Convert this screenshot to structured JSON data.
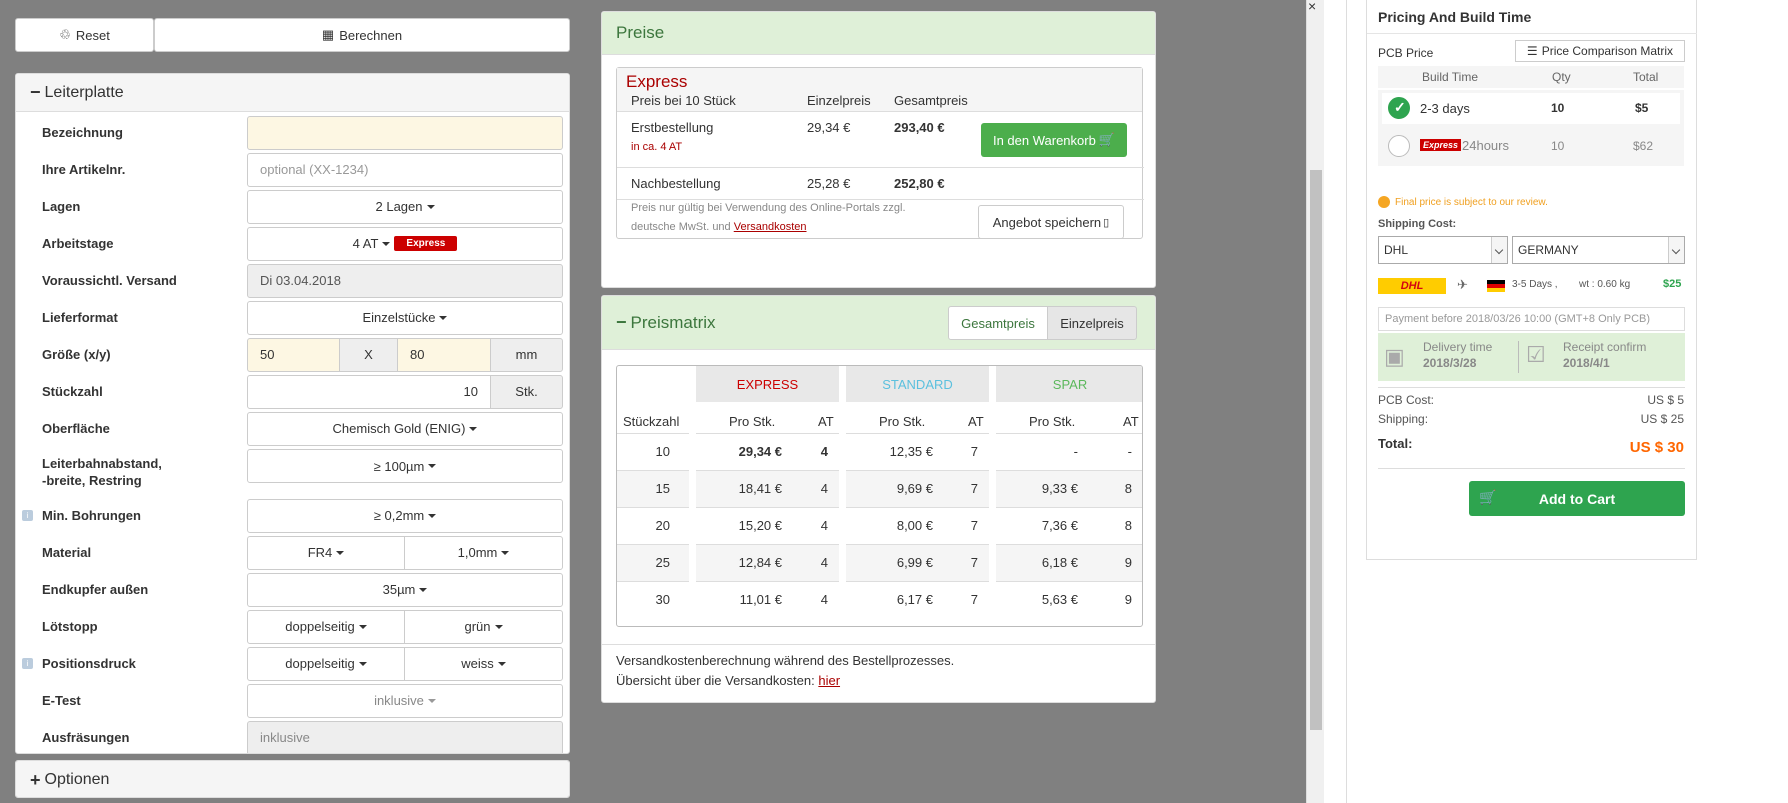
{
  "toolbar": {
    "reset_label": "Reset",
    "calc_label": "Berechnen"
  },
  "leiterplatte": {
    "title": "Leiterplatte",
    "bezeichnung_label": "Bezeichnung",
    "artikel_label": "Ihre Artikelnr.",
    "artikel_placeholder": "optional (XX-1234)",
    "lagen_label": "Lagen",
    "lagen_value": "2 Lagen",
    "arbeitstage_label": "Arbeitstage",
    "arbeitstage_value": "4 AT",
    "arbeitstage_badge": "Express",
    "versand_label": "Voraussichtl. Versand",
    "versand_value": "Di 03.04.2018",
    "lieferformat_label": "Lieferformat",
    "lieferformat_value": "Einzelstücke",
    "groesse_label": "Größe (x/y)",
    "groesse_x": "50",
    "groesse_sep": "X",
    "groesse_y": "80",
    "groesse_unit": "mm",
    "stueckzahl_label": "Stückzahl",
    "stueckzahl_value": "10",
    "stueckzahl_unit": "Stk.",
    "oberflaeche_label": "Oberfläche",
    "oberflaeche_value": "Chemisch Gold (ENIG)",
    "abstand_label_1": "Leiterbahnabstand,",
    "abstand_label_2": "-breite, Restring",
    "abstand_value": "≥ 100µm",
    "bohrungen_label": "Min. Bohrungen",
    "bohrungen_value": "≥ 0,2mm",
    "material_label": "Material",
    "material_value": "FR4",
    "material_thickness": "1,0mm",
    "endkupfer_label": "Endkupfer außen",
    "endkupfer_value": "35µm",
    "loetstopp_label": "Lötstopp",
    "loetstopp_value": "doppelseitig",
    "loetstopp_color": "grün",
    "positionsdruck_label": "Positionsdruck",
    "positionsdruck_value": "doppelseitig",
    "positionsdruck_color": "weiss",
    "etest_label": "E-Test",
    "etest_value": "inklusive",
    "ausfraesungen_label": "Ausfräsungen",
    "ausfraesungen_value": "inklusive"
  },
  "optionen": {
    "title": "Optionen"
  },
  "preise": {
    "title": "Preise",
    "express": "Express",
    "subtitle": "Preis bei 10 Stück",
    "col_einzel": "Einzelpreis",
    "col_gesamt": "Gesamtpreis",
    "erst_label": "Erstbestellung",
    "erst_sub": "in ca. 4 AT",
    "erst_einzel": "29,34 €",
    "erst_gesamt": "293,40 €",
    "cart_btn": "In den Warenkorb",
    "nach_label": "Nachbestellung",
    "nach_einzel": "25,28 €",
    "nach_gesamt": "252,80 €",
    "note_1": "Preis nur gültig bei Verwendung des Online-Portals zzgl.",
    "note_2": "deutsche MwSt. und ",
    "note_link": "Versandkosten",
    "angebot_btn": "Angebot speichern"
  },
  "preismatrix": {
    "title": "Preismatrix",
    "toggle_gesamt": "Gesamtpreis",
    "toggle_einzel": "Einzelpreis",
    "group_express": "EXPRESS",
    "group_standard": "STANDARD",
    "group_spar": "SPAR",
    "col_qty": "Stückzahl",
    "col_pro": "Pro Stk.",
    "col_at": "AT",
    "rows": [
      {
        "qty": "10",
        "ex": "29,34 €",
        "ex_at": "4",
        "st": "12,35 €",
        "st_at": "7",
        "sp": "-",
        "sp_at": "-"
      },
      {
        "qty": "15",
        "ex": "18,41 €",
        "ex_at": "4",
        "st": "9,69 €",
        "st_at": "7",
        "sp": "9,33 €",
        "sp_at": "8"
      },
      {
        "qty": "20",
        "ex": "15,20 €",
        "ex_at": "4",
        "st": "8,00 €",
        "st_at": "7",
        "sp": "7,36 €",
        "sp_at": "8"
      },
      {
        "qty": "25",
        "ex": "12,84 €",
        "ex_at": "4",
        "st": "6,99 €",
        "st_at": "7",
        "sp": "6,18 €",
        "sp_at": "9"
      },
      {
        "qty": "30",
        "ex": "11,01 €",
        "ex_at": "4",
        "st": "6,17 €",
        "st_at": "7",
        "sp": "5,63 €",
        "sp_at": "9"
      }
    ],
    "footer_1": "Versandkostenberechnung während des Bestellprozesses.",
    "footer_2": "Übersicht über die Versandkosten: ",
    "footer_link": "hier"
  },
  "pricing": {
    "title": "Pricing And Build Time",
    "pcb_price_label": "PCB Price",
    "matrix_btn": "Price Comparison Matrix",
    "col_build": "Build Time",
    "col_qty": "Qty",
    "col_total": "Total",
    "opt1_time": "2-3 days",
    "opt1_qty": "10",
    "opt1_total": "$5",
    "opt2_badge": "Express",
    "opt2_time": "24hours",
    "opt2_qty": "10",
    "opt2_total": "$62",
    "final_note": "Final price is subject to our review.",
    "shipping_label": "Shipping Cost:",
    "carrier": "DHL",
    "country": "GERMANY",
    "dhl_logo": "DHL",
    "ship_days": "3-5 Days ,",
    "ship_wt": "wt : 0.60 kg",
    "ship_price": "$25",
    "payment_note": "Payment before 2018/03/26 10:00 (GMT+8 Only PCB)",
    "delivery_label": "Delivery time",
    "delivery_date": "2018/3/28",
    "receipt_label": "Receipt confirm",
    "receipt_date": "2018/4/1",
    "pcb_cost_label": "PCB Cost:",
    "pcb_cost_value": "US $ 5",
    "shipping_cost_label": "Shipping:",
    "shipping_cost_value": "US $ 25",
    "total_label": "Total:",
    "total_value": "US $ 30",
    "add_cart": "Add to Cart"
  },
  "colors": {
    "green": "#2ea44f",
    "express_red": "#c00000",
    "panel_green": "#dff0d8",
    "total_orange": "#f60"
  }
}
